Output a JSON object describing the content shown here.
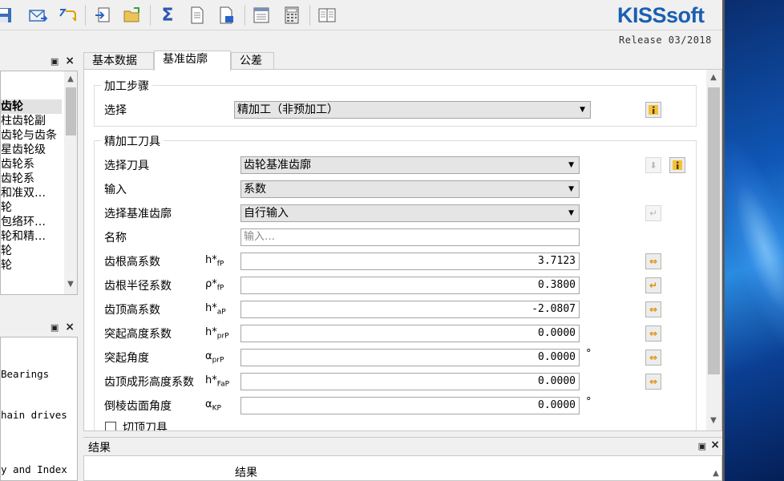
{
  "app": {
    "logo": "KISSsoft",
    "release": "Release 03/2018"
  },
  "toolbar": {
    "icons": [
      "save-icon",
      "email-icon",
      "undo-icon",
      "import-icon",
      "open-folder-icon",
      "sigma-icon",
      "document-icon",
      "document-export-icon",
      "report-icon",
      "calculator-icon",
      "book-icon"
    ]
  },
  "tree": {
    "items": [
      "齿轮",
      "柱齿轮副",
      "齿轮与齿条",
      "星齿轮级",
      "齿轮系",
      "齿轮系",
      "和准双…",
      "轮",
      "包络环…",
      "轮和精…",
      "轮",
      "轮"
    ],
    "selected_index": 0
  },
  "bottom_left": {
    "items": [
      "Bearings",
      "hain drives",
      "y and Index"
    ]
  },
  "tabs": [
    "基本数据",
    "基准齿廓",
    "公差"
  ],
  "active_tab": 1,
  "process": {
    "title": "加工步骤",
    "label": "选择",
    "value": "精加工（非预加工）"
  },
  "tool": {
    "title": "精加工刀具",
    "select_tool_label": "选择刀具",
    "select_tool_value": "齿轮基准齿廓",
    "input_label": "输入",
    "input_value": "系数",
    "profile_label": "选择基准齿廓",
    "profile_value": "自行输入",
    "name_label": "名称",
    "name_placeholder": "输入…",
    "params": [
      {
        "label": "齿根高系数",
        "sym": "h*",
        "sub": "fP",
        "value": "3.7123",
        "unit": ""
      },
      {
        "label": "齿根半径系数",
        "sym": "ρ*",
        "sub": "fP",
        "value": "0.3800",
        "unit": ""
      },
      {
        "label": "齿顶高系数",
        "sym": "h*",
        "sub": "aP",
        "value": "-2.0807",
        "unit": ""
      },
      {
        "label": "突起高度系数",
        "sym": "h*",
        "sub": "prP",
        "value": "0.0000",
        "unit": ""
      },
      {
        "label": "突起角度",
        "sym": "α",
        "sub": "prP",
        "value": "0.0000",
        "unit": "°"
      },
      {
        "label": "齿顶成形高度系数",
        "sym": "h*",
        "sub": "FaP",
        "value": "0.0000",
        "unit": ""
      },
      {
        "label": "倒棱齿面角度",
        "sym": "α",
        "sub": "KP",
        "value": "0.0000",
        "unit": "°"
      }
    ],
    "tip_tool_label": "切顶刀具"
  },
  "results": {
    "title": "结果",
    "header": "结果"
  }
}
